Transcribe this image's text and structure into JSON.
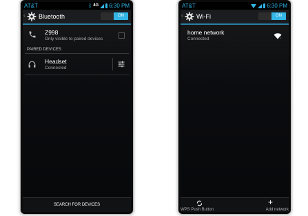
{
  "left": {
    "status": {
      "carrier": "AT&T",
      "time": "6:30 PM",
      "network_badge": "4G"
    },
    "title": "Bluetooth",
    "toggle": "ON",
    "device": {
      "name": "Z998",
      "subtitle": "Only visible to paired devices"
    },
    "paired_header": "PAIRED DEVICES",
    "paired": [
      {
        "name": "Headset",
        "status": "Connected"
      }
    ],
    "bottom_button": "SEARCH FOR DEVICES"
  },
  "right": {
    "status": {
      "carrier": "AT&T",
      "time": "6:30 PM"
    },
    "title": "Wi-Fi",
    "toggle": "ON",
    "network": {
      "name": "home network",
      "status": "Connected"
    },
    "bottom": {
      "wps": "WPS Push Button",
      "add": "Add network"
    }
  },
  "colors": {
    "accent": "#33b5e5",
    "background": "#0b0c0f"
  },
  "icons": {
    "back": "chevron-left",
    "gear": "gear",
    "phone": "phone",
    "headset": "headphones",
    "settings": "sliders",
    "wifi": "wifi",
    "wps": "wps",
    "add": "plus"
  }
}
